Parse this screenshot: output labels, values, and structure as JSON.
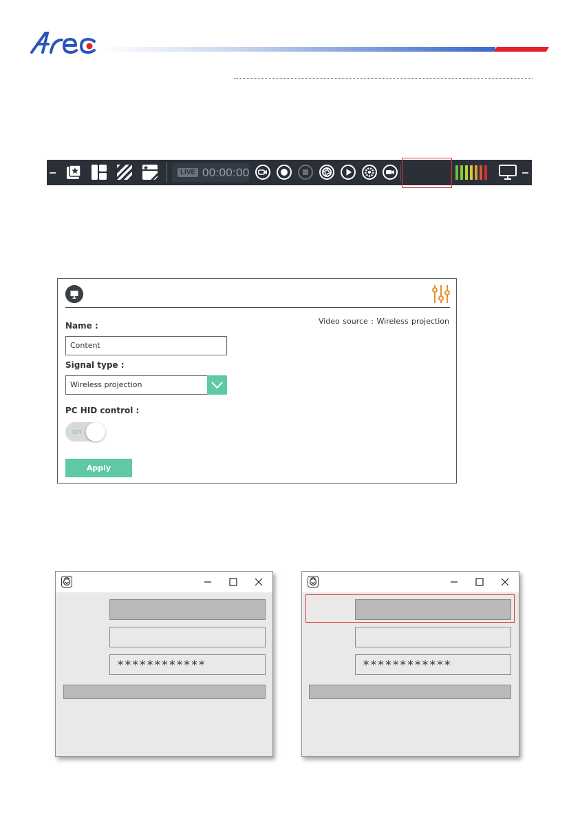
{
  "header": {
    "logo_alt": "Arec"
  },
  "toolbar": {
    "live_badge": "LIVE",
    "timer": "00:00:00",
    "meter_colors": [
      "#6fbf3a",
      "#8ec63f",
      "#b6cf3a",
      "#d9c53a",
      "#e39a33",
      "#d9553a",
      "#c8323a"
    ]
  },
  "panel": {
    "name_label": "Name :",
    "name_value": "Content",
    "video_source_label": "Video source :",
    "video_source_value": "Wireless projection",
    "signal_type_label": "Signal type :",
    "signal_type_value": "Wireless projection",
    "pc_hid_label": "PC HID control :",
    "toggle_state": "on",
    "apply_label": "Apply",
    "accent": "#5fc8a7",
    "settings_icon_color": "#e6902b"
  },
  "dialogs": [
    {
      "password_mask": "************",
      "highlighted": false
    },
    {
      "password_mask": "************",
      "highlighted": true
    }
  ]
}
